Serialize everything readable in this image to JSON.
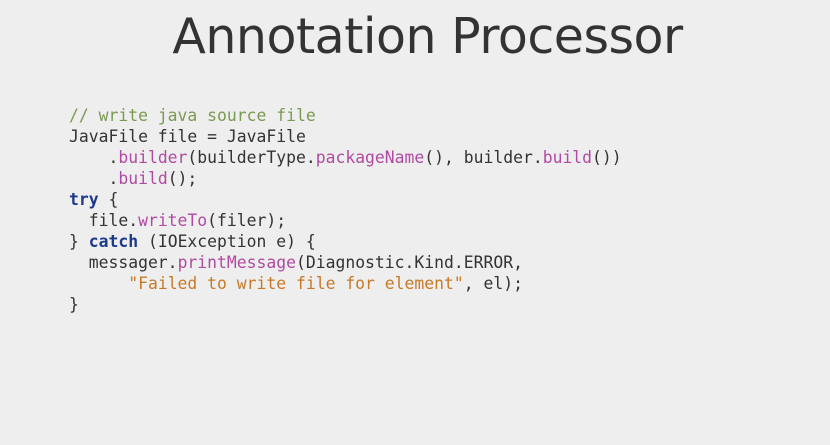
{
  "slide": {
    "title": "Annotation Processor"
  },
  "code": {
    "lines": [
      [
        {
          "t": "comment",
          "v": "// write java source file"
        }
      ],
      [
        {
          "t": "plain",
          "v": "JavaFile file = JavaFile"
        }
      ],
      [
        {
          "t": "plain",
          "v": "    ."
        },
        {
          "t": "method",
          "v": "builder"
        },
        {
          "t": "plain",
          "v": "(builderType."
        },
        {
          "t": "method",
          "v": "packageName"
        },
        {
          "t": "plain",
          "v": "(), builder."
        },
        {
          "t": "method",
          "v": "build"
        },
        {
          "t": "plain",
          "v": "())"
        }
      ],
      [
        {
          "t": "plain",
          "v": "    ."
        },
        {
          "t": "method",
          "v": "build"
        },
        {
          "t": "plain",
          "v": "();"
        }
      ],
      [
        {
          "t": "keyword",
          "v": "try"
        },
        {
          "t": "plain",
          "v": " {"
        }
      ],
      [
        {
          "t": "plain",
          "v": "  file."
        },
        {
          "t": "method",
          "v": "writeTo"
        },
        {
          "t": "plain",
          "v": "(filer);"
        }
      ],
      [
        {
          "t": "plain",
          "v": "} "
        },
        {
          "t": "keyword",
          "v": "catch"
        },
        {
          "t": "plain",
          "v": " (IOException e) {"
        }
      ],
      [
        {
          "t": "plain",
          "v": "  messager."
        },
        {
          "t": "method",
          "v": "printMessage"
        },
        {
          "t": "plain",
          "v": "(Diagnostic.Kind.ERROR,"
        }
      ],
      [
        {
          "t": "plain",
          "v": "      "
        },
        {
          "t": "string",
          "v": "\"Failed to write file for element\""
        },
        {
          "t": "plain",
          "v": ", el);"
        }
      ],
      [
        {
          "t": "plain",
          "v": "}"
        }
      ]
    ]
  },
  "colors": {
    "background": "#eeeeee",
    "text": "#333333",
    "comment": "#7a9a51",
    "method": "#b04aa2",
    "keyword": "#1d3a8a",
    "string": "#c67a28"
  }
}
